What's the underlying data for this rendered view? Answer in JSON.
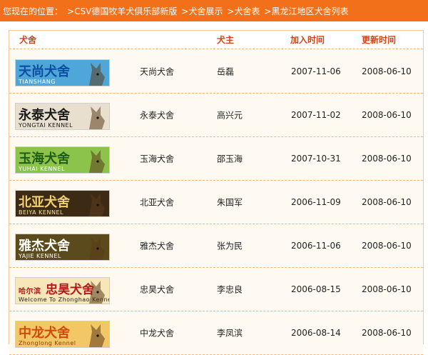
{
  "breadcrumb": {
    "prefix": "您现在的位置：",
    "items": [
      ">CSV德国牧羊犬俱乐部新版",
      ">犬舍展示",
      ">犬舍表",
      ">黑龙江地区犬舍列表"
    ]
  },
  "table": {
    "headers": {
      "kennel": "犬舍",
      "owner": "犬主",
      "joined": "加入时间",
      "updated": "更新时间"
    },
    "rows": [
      {
        "name": "天尚犬舍",
        "owner": "岳磊",
        "joined": "2007-11-06",
        "updated": "2008-06-10",
        "banner": {
          "title": "天尚犬舍",
          "subtitle": "TIANSHANG",
          "bg": "#4fa6d8",
          "fg": "#0a4fa0",
          "sub_fg": "#ffffff"
        }
      },
      {
        "name": "永泰犬舍",
        "owner": "高兴元",
        "joined": "2007-11-02",
        "updated": "2008-06-10",
        "banner": {
          "title": "永泰犬舍",
          "subtitle": "YONGTAI KENNEL",
          "bg": "#e8dfcf",
          "fg": "#1a1a1a",
          "sub_fg": "#1a1a1a"
        }
      },
      {
        "name": "玉海犬舍",
        "owner": "邵玉海",
        "joined": "2007-10-31",
        "updated": "2008-06-10",
        "banner": {
          "title": "玉海犬舍",
          "subtitle": "YUHAI KENNEL",
          "bg": "#8cc34a",
          "fg": "#1f5c1a",
          "sub_fg": "#ffffff"
        }
      },
      {
        "name": "北亚犬舍",
        "owner": "朱国军",
        "joined": "2006-11-09",
        "updated": "2008-06-10",
        "banner": {
          "title": "北亚犬舍",
          "subtitle": "BEIYA KENNEL",
          "bg": "#3d2a14",
          "fg": "#f0d070",
          "sub_fg": "#f5e6a8"
        }
      },
      {
        "name": "雅杰犬舍",
        "owner": "张为民",
        "joined": "2006-11-06",
        "updated": "2008-06-10",
        "banner": {
          "title": "雅杰犬舍",
          "subtitle": "YAJIE KENNEL",
          "bg": "#5a4a1c",
          "fg": "#ffffff",
          "sub_fg": "#ffffff"
        }
      },
      {
        "name": "忠昊犬舍",
        "owner": "李忠良",
        "joined": "2006-08-15",
        "updated": "2008-06-10",
        "banner": {
          "title": "忠昊犬舍",
          "prefix": "哈尔滨",
          "subtitle": "Welcome To Zhonghao Kennel",
          "bg": "#f7e7b8",
          "fg": "#b3191b",
          "sub_fg": "#222222"
        }
      },
      {
        "name": "中龙犬舍",
        "owner": "李凤滨",
        "joined": "2006-08-14",
        "updated": "2008-06-10",
        "banner": {
          "title": "中龙犬舍",
          "subtitle": "Zhonglong Kennel",
          "bg": "#f2c766",
          "fg": "#d14a0c",
          "sub_fg": "#8b3a0a"
        }
      }
    ]
  }
}
